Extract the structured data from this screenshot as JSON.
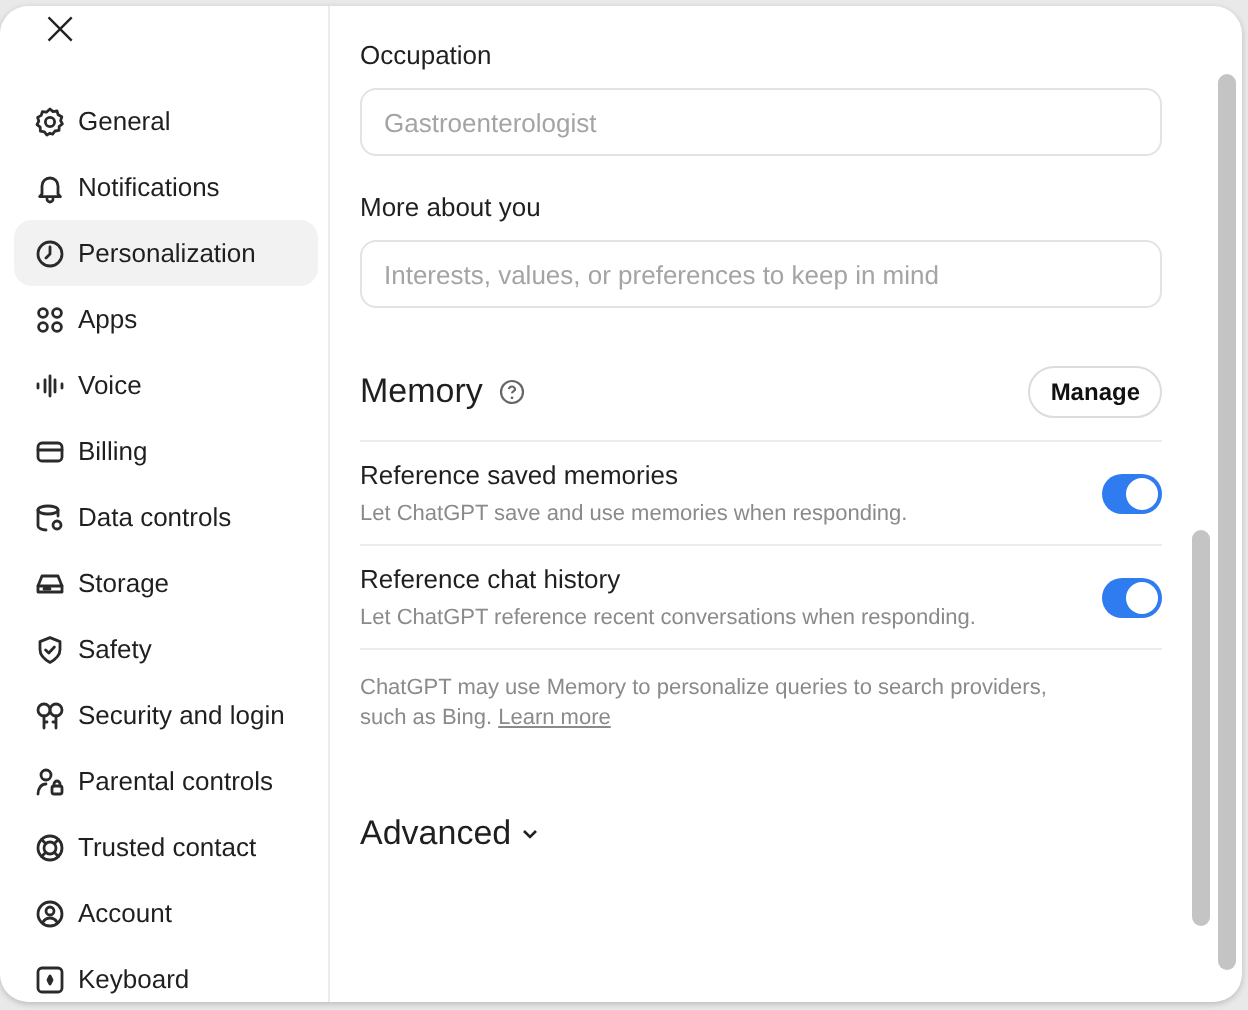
{
  "close": {
    "label": "×"
  },
  "sidebar": {
    "items": [
      {
        "label": "General",
        "selected": false
      },
      {
        "label": "Notifications",
        "selected": false
      },
      {
        "label": "Personalization",
        "selected": true
      },
      {
        "label": "Apps",
        "selected": false
      },
      {
        "label": "Voice",
        "selected": false
      },
      {
        "label": "Billing",
        "selected": false
      },
      {
        "label": "Data controls",
        "selected": false
      },
      {
        "label": "Storage",
        "selected": false
      },
      {
        "label": "Safety",
        "selected": false
      },
      {
        "label": "Security and login",
        "selected": false
      },
      {
        "label": "Parental controls",
        "selected": false
      },
      {
        "label": "Trusted contact",
        "selected": false
      },
      {
        "label": "Account",
        "selected": false
      },
      {
        "label": "Keyboard",
        "selected": false
      }
    ]
  },
  "fields": [
    {
      "label": "Occupation",
      "placeholder": "Gastroenterologist"
    },
    {
      "label": "More about you",
      "placeholder": "Interests, values, or preferences to keep in mind"
    }
  ],
  "memory": {
    "title": "Memory",
    "manage_button": "Manage",
    "settings": [
      {
        "title": "Reference saved memories",
        "description": "Let ChatGPT save and use memories when responding.",
        "on": true
      },
      {
        "title": "Reference chat history",
        "description": "Let ChatGPT reference recent conversations when responding.",
        "on": true
      }
    ],
    "note": "ChatGPT may use Memory to personalize queries to search providers, such as Bing.",
    "link": "Learn more"
  },
  "advanced": {
    "label": "Advanced",
    "expanded": false
  }
}
